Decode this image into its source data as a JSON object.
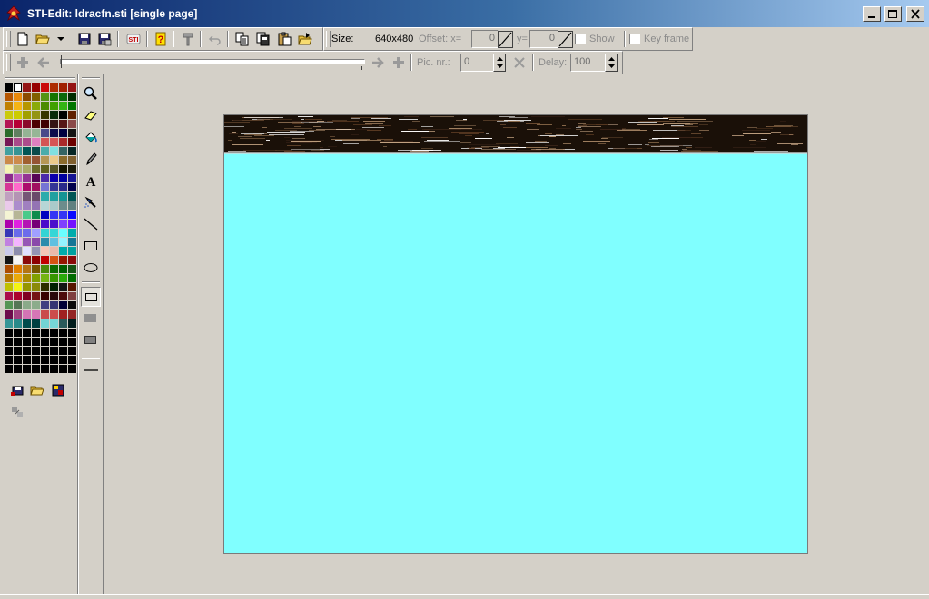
{
  "window": {
    "title": "STI-Edit: ldracfn.sti [single page]",
    "controls": [
      "minimize",
      "maximize",
      "close"
    ]
  },
  "toolbar_top": {
    "size_label": "Size:",
    "size_value": "640x480",
    "offset_label": "Offset: x=",
    "offset_x_value": "0",
    "y_label": "y=",
    "offset_y_value": "0",
    "show_label": "Show",
    "keyframe_label": "Key frame"
  },
  "toolbar_anim": {
    "picnr_label": "Pic. nr.:",
    "picnr_value": "0",
    "delay_label": "Delay:",
    "delay_value": "100"
  },
  "colors": {
    "canvas_fill": "#80ffff",
    "titlebar_start": "#0a246a",
    "titlebar_end": "#a6caf0",
    "background": "#d4d0c8"
  },
  "tools": [
    "zoom-icon",
    "eraser-icon",
    "fill-bucket-icon",
    "pencil-icon",
    "text-icon",
    "airbrush-icon",
    "line-icon",
    "rectangle-icon",
    "ellipse-icon"
  ],
  "fill_modes": [
    "outline",
    "filled",
    "filled-outline"
  ],
  "image": {
    "width": 640,
    "height": 480
  }
}
